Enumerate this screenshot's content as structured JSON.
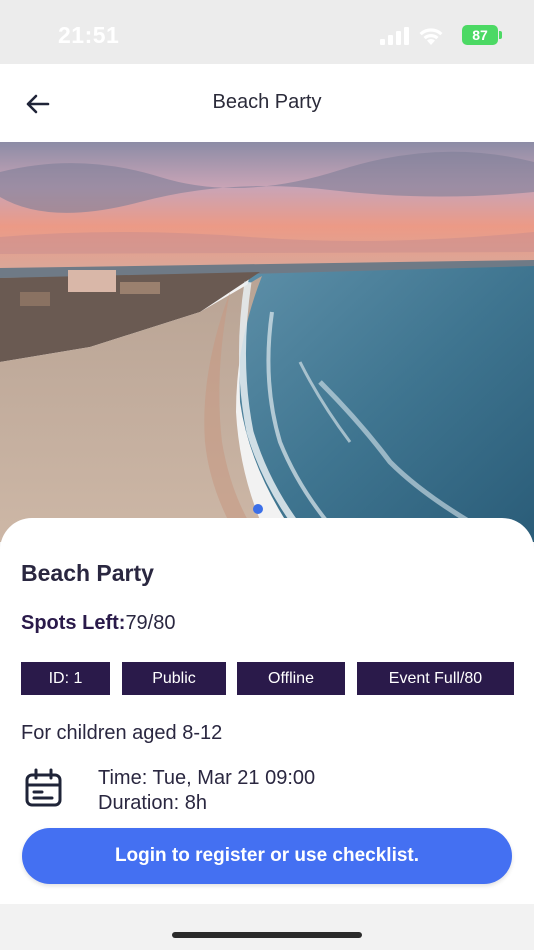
{
  "status_bar": {
    "time": "21:51",
    "battery": "87",
    "icons": [
      "signal-icon",
      "wifi-icon",
      "battery-icon"
    ]
  },
  "nav": {
    "title": "Beach Party",
    "back_icon": "arrow-left-icon"
  },
  "hero": {
    "image": "beach-aerial-photo",
    "pager_active_color": "#3b6fe8"
  },
  "event": {
    "title": "Beach Party",
    "spots_label": "Spots Left:",
    "spots_value": "79/80",
    "tags": [
      "ID: 1",
      "Public",
      "Offline",
      "Event Full/80"
    ],
    "age": "For children aged 8-12",
    "time": "Time: Tue, Mar 21 09:00",
    "duration": "Duration: 8h",
    "calendar_icon": "calendar-icon"
  },
  "actions": {
    "login_label": "Login to register or use checklist."
  },
  "colors": {
    "tag_bg": "#2a1a4a",
    "primary_button": "#4470f2",
    "battery": "#4cd964"
  }
}
